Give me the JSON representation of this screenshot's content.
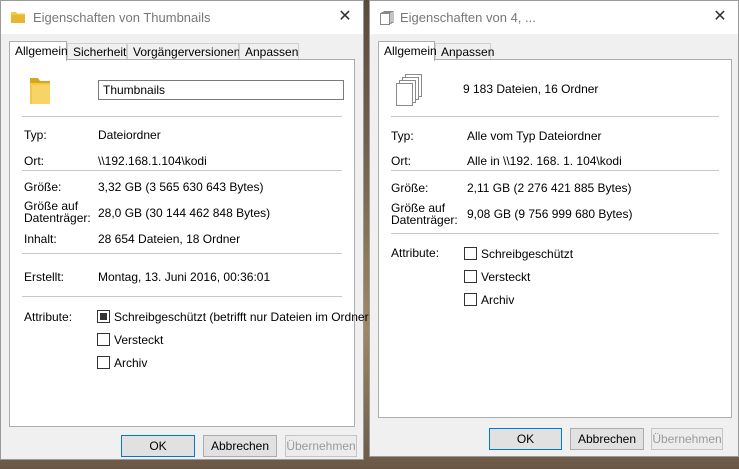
{
  "win1": {
    "title": "Eigenschaften von Thumbnails",
    "tabs": [
      "Allgemein",
      "Sicherheit",
      "Vorgängerversionen",
      "Anpassen"
    ],
    "name_value": "Thumbnails",
    "typ_label": "Typ:",
    "typ_value": "Dateiordner",
    "ort_label": "Ort:",
    "ort_value": "\\\\192.168.1.104\\kodi",
    "groesse_label": "Größe:",
    "groesse_value": "3,32 GB (3 565 630 643 Bytes)",
    "groesse_dt_label_1": "Größe auf",
    "groesse_dt_label_2": "Datenträger:",
    "groesse_dt_value": "28,0 GB (30 144 462 848 Bytes)",
    "inhalt_label": "Inhalt:",
    "inhalt_value": "28 654 Dateien, 18 Ordner",
    "erstellt_label": "Erstellt:",
    "erstellt_value": "Montag, 13. Juni 2016, 00:36:01",
    "attribute_label": "Attribute:",
    "attributes": [
      {
        "label": "Schreibgeschützt (betrifft nur Dateien im Ordner)",
        "checked": "indeterminate"
      },
      {
        "label": "Versteckt",
        "checked": false
      },
      {
        "label": "Archiv",
        "checked": false
      }
    ],
    "buttons": {
      "ok": "OK",
      "cancel": "Abbrechen",
      "apply": "Übernehmen"
    }
  },
  "win2": {
    "title": "Eigenschaften von 4, ...",
    "tabs": [
      "Allgemein",
      "Anpassen"
    ],
    "summary": "9 183 Dateien, 16 Ordner",
    "typ_label": "Typ:",
    "typ_value": "Alle vom Typ Dateiordner",
    "ort_label": "Ort:",
    "ort_value": "Alle in \\\\192. 168. 1. 104\\kodi",
    "groesse_label": "Größe:",
    "groesse_value": "2,11 GB (2 276 421 885 Bytes)",
    "groesse_dt_label_1": "Größe auf",
    "groesse_dt_label_2": "Datenträger:",
    "groesse_dt_value": "9,08 GB (9 756 999 680 Bytes)",
    "attribute_label": "Attribute:",
    "attributes": [
      {
        "label": "Schreibgeschützt",
        "checked": false
      },
      {
        "label": "Versteckt",
        "checked": false
      },
      {
        "label": "Archiv",
        "checked": false
      }
    ],
    "buttons": {
      "ok": "OK",
      "cancel": "Abbrechen",
      "apply": "Übernehmen"
    }
  },
  "colors": {
    "folder": "#f5c842",
    "accent": "#0078d7"
  },
  "icons": {
    "folder": "folder-icon",
    "files": "multiple-files-icon",
    "close": "close-icon"
  }
}
